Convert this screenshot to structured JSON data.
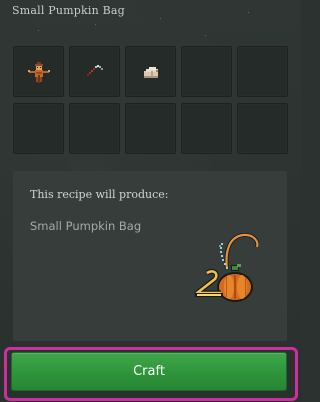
{
  "window": {
    "title": "Small Pumpkin Bag"
  },
  "recipe": {
    "ingredients": [
      {
        "icon": "scarecrow-icon"
      },
      {
        "icon": "pickaxe-icon"
      },
      {
        "icon": "cloth-bundle-icon"
      },
      {
        "icon": null
      },
      {
        "icon": null
      },
      {
        "icon": null
      },
      {
        "icon": null
      },
      {
        "icon": null
      },
      {
        "icon": null
      },
      {
        "icon": null
      }
    ]
  },
  "result": {
    "heading": "This recipe will produce:",
    "item_name": "Small Pumpkin Bag",
    "icon": "pumpkin-bag-icon"
  },
  "actions": {
    "craft_label": "Craft"
  },
  "colors": {
    "background": "#2b3230",
    "slot": "#252b29",
    "panel": "#363d3b",
    "craft_button": "#2f963c",
    "highlight_outline": "#cc2f9f"
  }
}
